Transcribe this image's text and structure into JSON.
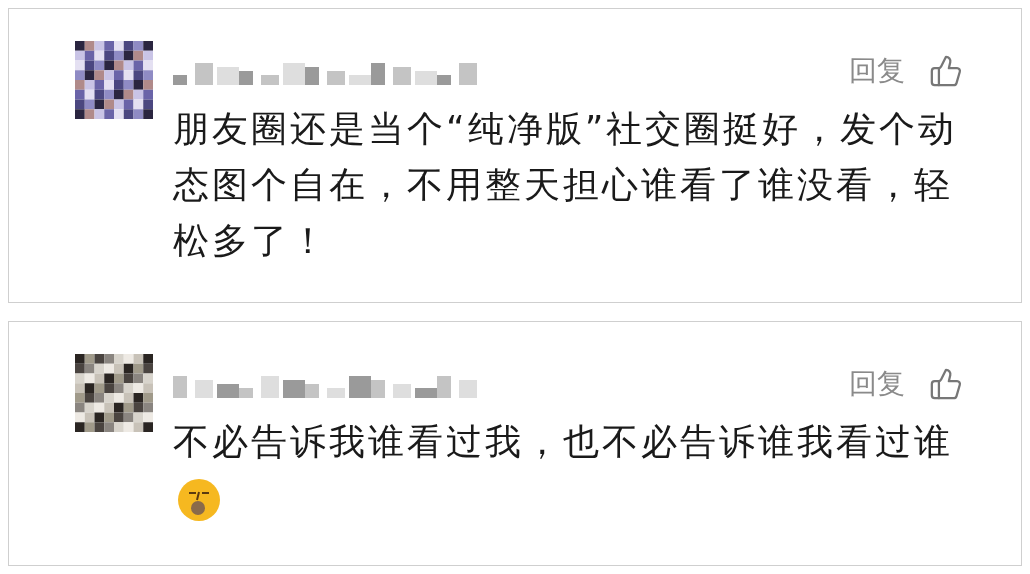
{
  "comments": [
    {
      "text": "朋友圈还是当个“纯净版”社交圈挺好，发个动态图个自在，不用整天担心谁看了谁没看，轻松多了！",
      "has_emoji": false,
      "reply": "回复"
    },
    {
      "text": "不必告诉我谁看过我，也不必告诉谁我看过谁",
      "has_emoji": true,
      "reply": "回复"
    }
  ]
}
